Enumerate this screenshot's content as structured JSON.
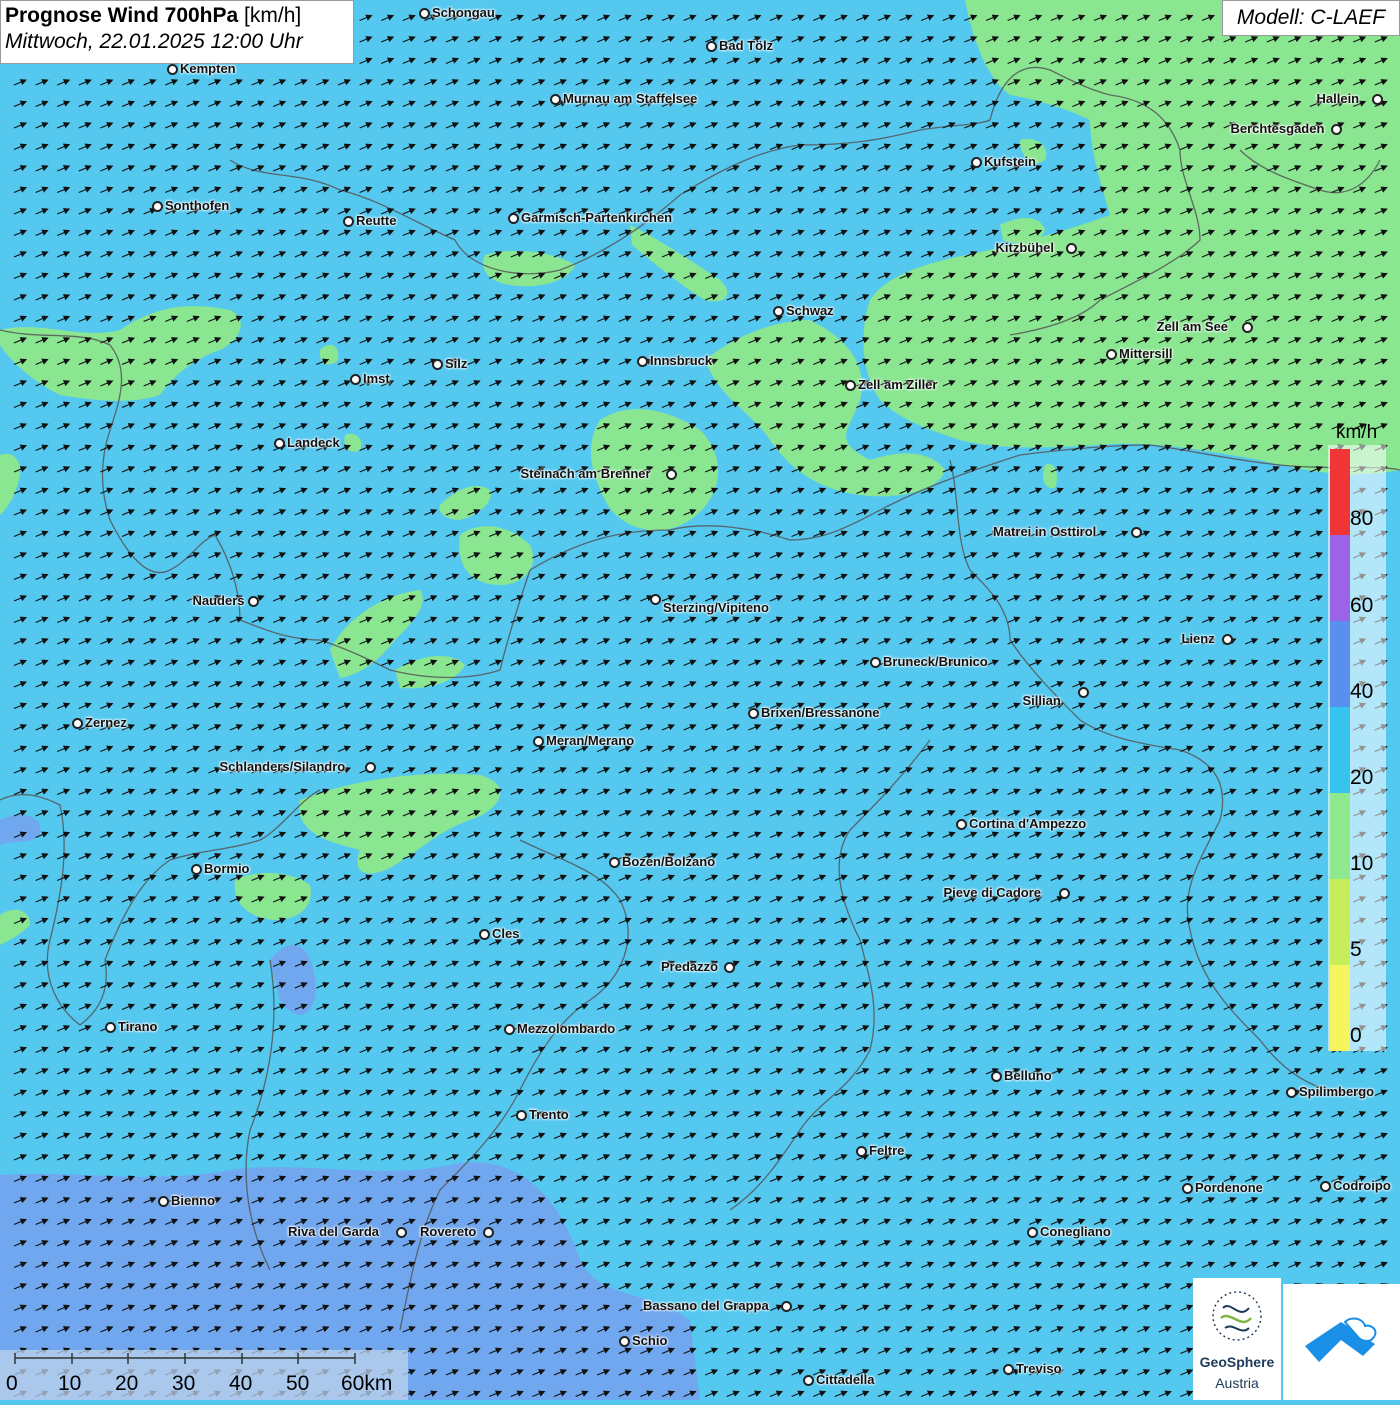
{
  "title": {
    "main": "Prognose Wind 700hPa",
    "unit": "[km/h]",
    "datetime": "Mittwoch, 22.01.2025 12:00 Uhr"
  },
  "model": "Modell: C-LAEF",
  "legend": {
    "unit": "km/h",
    "classes": [
      {
        "label": "0",
        "color": "#f5f560"
      },
      {
        "label": "5",
        "color": "#c6ee5a"
      },
      {
        "label": "10",
        "color": "#8ee88c"
      },
      {
        "label": "20",
        "color": "#36c4ef"
      },
      {
        "label": "40",
        "color": "#5a8fef"
      },
      {
        "label": "60",
        "color": "#9a63e8"
      },
      {
        "label": "80",
        "color": "#ef3535"
      }
    ]
  },
  "scalebar": {
    "labels": [
      "0",
      "10",
      "20",
      "30",
      "40",
      "50",
      "60km"
    ]
  },
  "wind": {
    "direction": "west-southwest",
    "dominant_class": "20"
  },
  "logos": {
    "name_bold": "GeoSphere",
    "name": "Austria"
  },
  "cities": [
    "Schongau",
    "Bad Tölz",
    "Kempten",
    "Murnau am Staffelsee",
    "Hallein",
    "Berchtesgaden",
    "Kufstein",
    "Sonthofen",
    "Reutte",
    "Garmisch-Partenkirchen",
    "Kitzbühel",
    "Schwaz",
    "Zell am See",
    "Mittersill",
    "Innsbruck",
    "Silz",
    "Imst",
    "Zell am Ziller",
    "Landeck",
    "Steinach am Brenner",
    "Matrei in Osttirol",
    "Nauders",
    "Sterzing/Vipiteno",
    "Lienz",
    "Bruneck/Brunico",
    "Sillian",
    "Brixen/Bressanone",
    "Zernez",
    "Meran/Merano",
    "Schlanders/Silandro",
    "Cortina d'Ampezzo",
    "Bozen/Bolzano",
    "Bormio",
    "Pieve di Cadore",
    "Cles",
    "Predazzo",
    "Tirano",
    "Mezzolombardo",
    "Belluno",
    "Spilimbergo",
    "Trento",
    "Feltre",
    "Pordenone",
    "Codroipo",
    "Bienno",
    "Riva del Garda",
    "Rovereto",
    "Conegliano",
    "Bassano del Grappa",
    "Schio",
    "Treviso",
    "Cittadella"
  ]
}
